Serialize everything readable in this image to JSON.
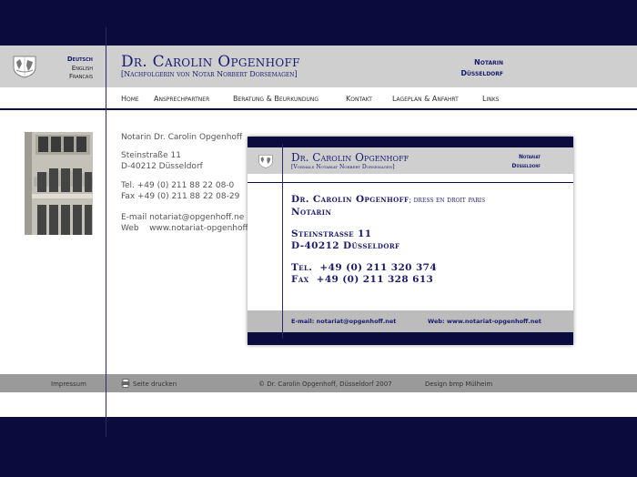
{
  "languages": [
    "Deutsch",
    "English",
    "Francais"
  ],
  "header": {
    "title": "Dr. Carolin Opgenhoff",
    "subtitle": "[Nachfolgerin von Notar Norbert Dorsemagen]",
    "role": "Notarin",
    "city": "Düsseldorf"
  },
  "nav": {
    "items": [
      "Home",
      "Ansprechpartner",
      "Beratung & Beurkundung",
      "Kontakt",
      "Lageplan & Anfahrt",
      "Links"
    ]
  },
  "content": {
    "name_line": "Notarin Dr. Carolin Opgenhoff",
    "street": "Steinstraße 11",
    "zip_city": "D-40212 Düsseldorf",
    "tel": "Tel. +49 (0) 211 88 22 08-0",
    "fax": "Fax +49 (0) 211 88 22 08-29",
    "email": "E-mail notariat@opgenhoff.ne",
    "web": "Web    www.notariat-opgenhoff"
  },
  "footer": {
    "impressum": "Impressum",
    "print": "Seite drucken",
    "copyright": "© Dr. Carolin Opgenhoff, Düsseldorf 2007",
    "design": "Design bmp Mülheim"
  },
  "card": {
    "title": "Dr. Carolin Opgenhoff",
    "subtitle": "[Vormals Notariat Norbert Dorsemagen]",
    "role": "Notariat",
    "city": "Düsseldorf",
    "name": "Dr. Carolin Opgenhoff",
    "name_note": "; dress en droit paris",
    "position": "Notarin",
    "street": "Steinstraße 11",
    "zip_city": "D-40212 Düsseldorf",
    "tel": "Tel.  +49 (0) 211 320 374",
    "fax": "Fax  +49 (0) 211 328 613",
    "email": "E-mail: notariat@opgenhoff.net",
    "web": "Web: www.notariat-opgenhoff.net"
  },
  "colors": {
    "navy": "#0b0b3d",
    "accent_text": "#1a1a70",
    "header_gray": "#cfcfcf",
    "footer_gray": "#9a9a9a"
  }
}
